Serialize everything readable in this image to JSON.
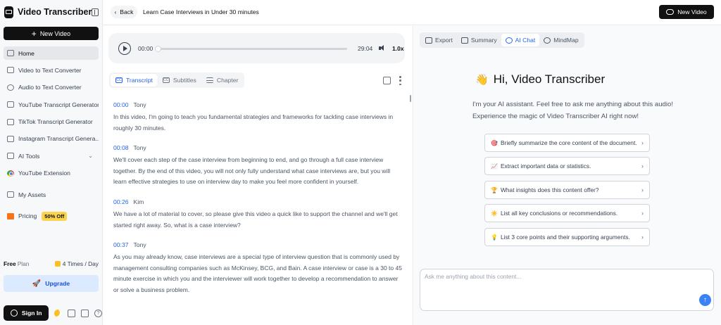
{
  "app": {
    "name": "Video Transcriber"
  },
  "sidebar": {
    "new_video_label": "New Video",
    "items": [
      {
        "label": "Home",
        "icon": "home-icon"
      },
      {
        "label": "Video to Text Converter",
        "icon": "video-icon"
      },
      {
        "label": "Audio to Text Converter",
        "icon": "audio-icon"
      },
      {
        "label": "YouTube Transcript Generator",
        "icon": "youtube-icon"
      },
      {
        "label": "TikTok Transcript Generator",
        "icon": "tiktok-icon"
      },
      {
        "label": "Instagram Transcript Genera...",
        "icon": "instagram-icon"
      },
      {
        "label": "AI Tools",
        "icon": "grid-icon"
      },
      {
        "label": "YouTube Extension",
        "icon": "chrome-icon"
      },
      {
        "label": "My Assets",
        "icon": "assets-icon"
      },
      {
        "label": "Pricing",
        "icon": "gift-icon"
      }
    ],
    "pricing_badge": "50% Off",
    "plan_free": "Free",
    "plan_word": "Plan",
    "plan_usage": "4 Times / Day",
    "upgrade_label": "Upgrade",
    "signin_label": "Sign In"
  },
  "topbar": {
    "back_label": "Back",
    "title": "Learn Case Interviews in Under 30 minutes",
    "new_video_label": "New Video"
  },
  "player": {
    "current_time": "00:00",
    "total_time": "29:04",
    "speed": "1.0x",
    "progress": 0
  },
  "transcript_tabs": [
    {
      "label": "Transcript"
    },
    {
      "label": "Subtitles"
    },
    {
      "label": "Chapter"
    }
  ],
  "transcript": [
    {
      "time": "00:00",
      "speaker": "Tony",
      "text": "In this video, I'm going to teach you fundamental strategies and frameworks for tackling case interviews in roughly 30 minutes."
    },
    {
      "time": "00:08",
      "speaker": "Tony",
      "text": "We'll cover each step of the case interview from beginning to end, and go through a full case interview together. By the end of this video, you will not only fully understand what case interviews are, but you will learn effective strategies to use on interview day to make you feel more confident in yourself."
    },
    {
      "time": "00:26",
      "speaker": "Kim",
      "text": "We have a lot of material to cover, so please give this video a quick like to support the channel and we'll get started right away. So, what is a case interview?"
    },
    {
      "time": "00:37",
      "speaker": "Tony",
      "text": "As you may already know, case interviews are a special type of interview question that is commonly used by management consulting companies such as McKinsey, BCG, and Bain. A case interview or case is a 30 to 45 minute exercise in which you and the interviewer will work together to develop a recommendation to answer or solve a business problem."
    }
  ],
  "right_tabs": [
    {
      "label": "Export"
    },
    {
      "label": "Summary"
    },
    {
      "label": "AI Chat"
    },
    {
      "label": "MindMap"
    }
  ],
  "chat": {
    "greeting": "Hi, Video Transcriber",
    "intro": "I'm your AI assistant. Feel free to ask me anything about this audio! Experience the magic of Video Transcriber AI right now!",
    "suggestions": [
      {
        "emoji": "🎯",
        "text": "Briefly summarize the core content of the document."
      },
      {
        "emoji": "📈",
        "text": "Extract important data or statistics."
      },
      {
        "emoji": "🏆",
        "text": "What insights does this content offer?"
      },
      {
        "emoji": "☀️",
        "text": "List all key conclusions or recommendations."
      },
      {
        "emoji": "💡",
        "text": "List 3 core points and their supporting arguments."
      }
    ],
    "input_placeholder": "Ask me anything about this content..."
  }
}
